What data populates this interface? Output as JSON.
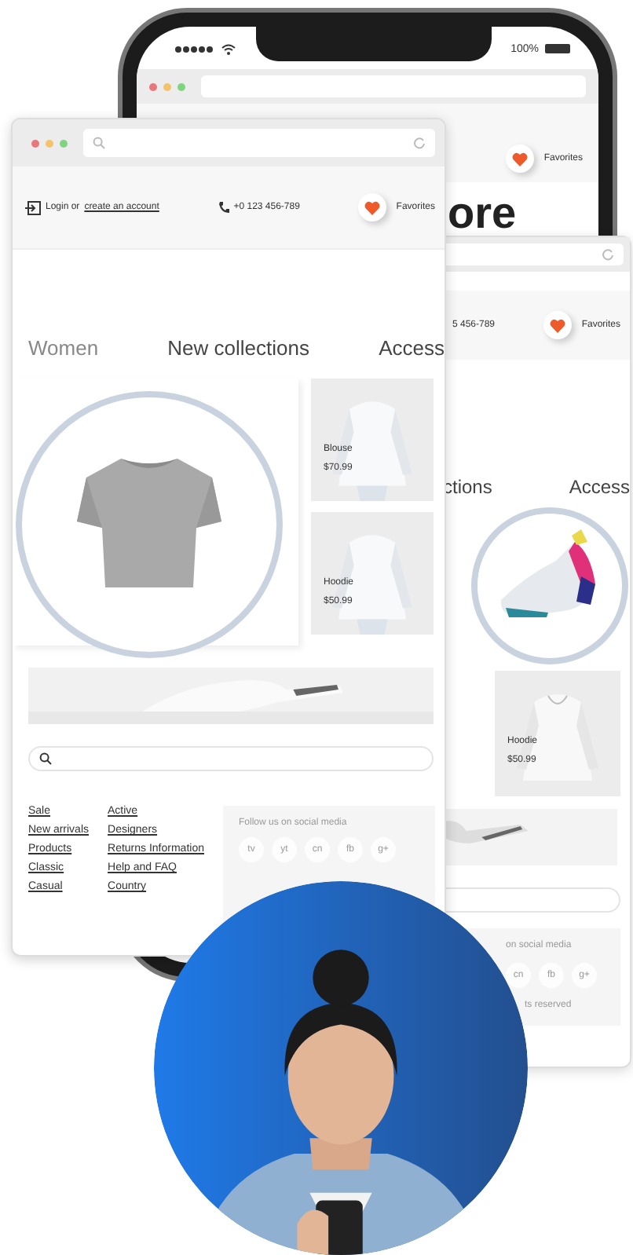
{
  "phone": {
    "battery": "100%",
    "favorites": "Favorites",
    "heading": "ore"
  },
  "front_window": {
    "login": "Login or",
    "login_link": "create an account",
    "phone": "+0 123 456-789",
    "favorites": "Favorites",
    "categories": [
      "Women",
      "New collections",
      "Access"
    ],
    "products": [
      {
        "name": "Blouse",
        "price": "$70.99"
      },
      {
        "name": "Hoodie",
        "price": "$50.99"
      }
    ],
    "footer_links": [
      [
        "Sale",
        "New arrivals",
        "Products",
        "Classic",
        "Casual"
      ],
      [
        "Active",
        "Designers",
        "Returns Information",
        "Help and FAQ",
        "Country"
      ]
    ],
    "social": {
      "title": "Follow us on social media",
      "icons": [
        "tv",
        "yt",
        "cn",
        "fb",
        "g+"
      ]
    }
  },
  "back_window": {
    "phone": "5 456-789",
    "favorites": "Favorites",
    "categories": [
      "ctions",
      "Access"
    ],
    "products": [
      {
        "name": "Hoodie",
        "price": "$50.99"
      }
    ],
    "social": {
      "title": "on social media",
      "icons": [
        "cn",
        "fb",
        "g+"
      ],
      "note": "ts reserved"
    }
  }
}
